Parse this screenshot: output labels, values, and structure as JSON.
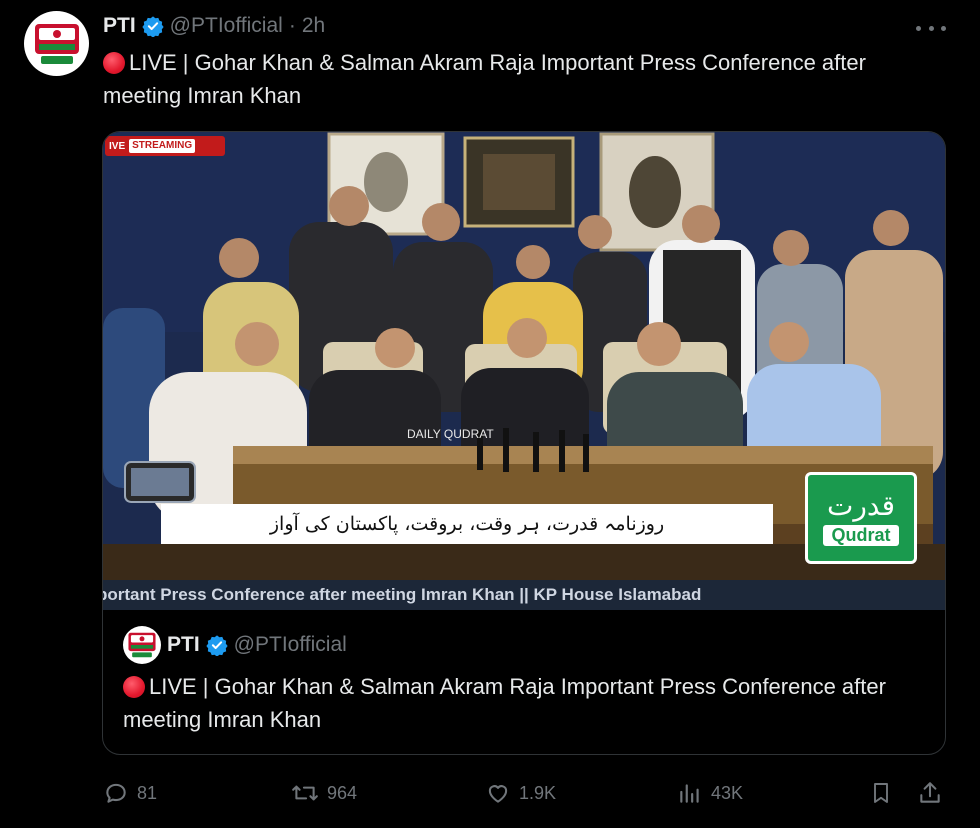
{
  "tweet": {
    "author_name": "PTI",
    "handle": "@PTIofficial",
    "separator": "·",
    "time": "2h",
    "text": "LIVE | Gohar Khan & Salman Akram Raja Important Press Conference after meeting Imran Khan"
  },
  "video": {
    "badge_prefix": "IVE",
    "badge_label": "STREAMING",
    "mic_brand": "DAILY QUDRAT",
    "urdu_caption": "روزنامہ قدرت، ہر وقت، بروقت، پاکستان کی آواز",
    "channel_logo_urdu": "قدرت",
    "channel_logo_en": "Qudrat",
    "ticker": "portant Press Conference after meeting Imran Khan || KP House Islamabad"
  },
  "quoted": {
    "author_name": "PTI",
    "handle": "@PTIofficial",
    "text": "LIVE | Gohar Khan & Salman Akram Raja Important Press Conference after meeting Imran Khan"
  },
  "actions": {
    "replies": "81",
    "reposts": "964",
    "likes": "1.9K",
    "views": "43K"
  },
  "colors": {
    "background": "#000000",
    "text": "#e7e9ea",
    "secondary": "#71767b",
    "verified": "#1d9bf0",
    "live_dot": "#e3182d",
    "border": "#2f3336"
  },
  "icons": [
    "pti-logo",
    "verified-icon",
    "more-icon",
    "live-dot-icon",
    "reply-icon",
    "repost-icon",
    "like-icon",
    "views-icon",
    "bookmark-icon",
    "share-icon"
  ]
}
